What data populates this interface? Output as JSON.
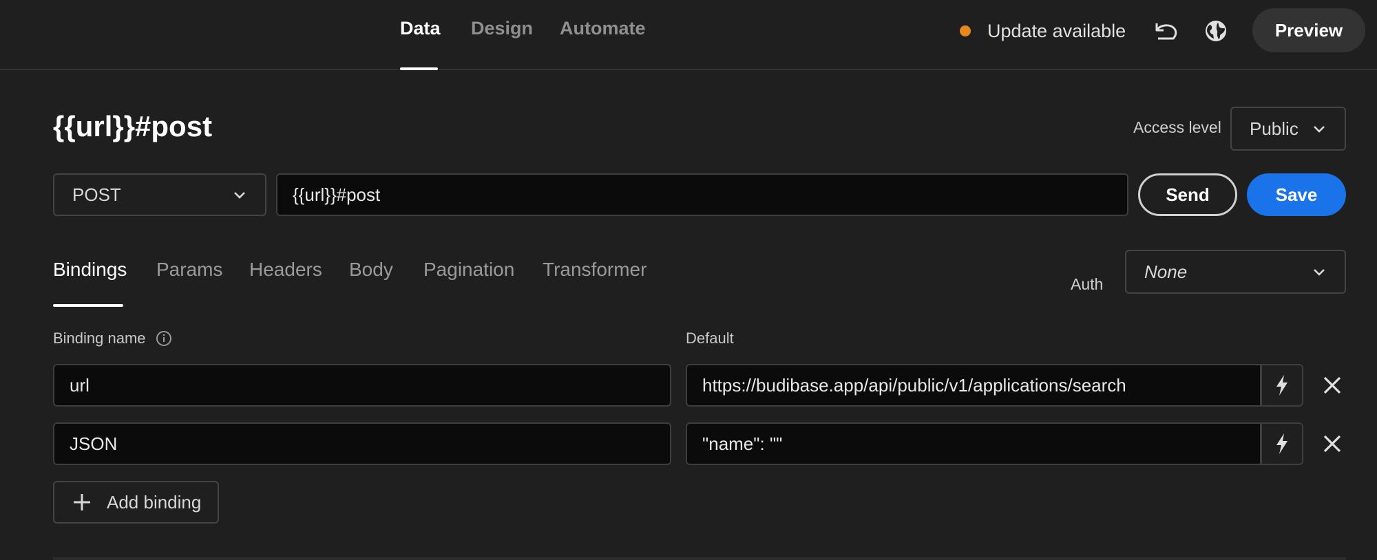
{
  "nav": {
    "tabs": [
      {
        "label": "Data",
        "active": true
      },
      {
        "label": "Design",
        "active": false
      },
      {
        "label": "Automate",
        "active": false
      }
    ],
    "update_text": "Update available",
    "update_color": "#e8871e",
    "preview_label": "Preview",
    "icons": [
      "undo-icon",
      "globe-icon"
    ]
  },
  "query": {
    "title": "{{url}}#post",
    "access_level_label": "Access level",
    "access_level_value": "Public",
    "method": "POST",
    "url": "{{url}}#post",
    "send_label": "Send",
    "save_label": "Save",
    "save_color": "#1a73e8"
  },
  "subtabs": [
    {
      "label": "Bindings",
      "active": true
    },
    {
      "label": "Params",
      "active": false
    },
    {
      "label": "Headers",
      "active": false
    },
    {
      "label": "Body",
      "active": false
    },
    {
      "label": "Pagination",
      "active": false
    },
    {
      "label": "Transformer",
      "active": false
    }
  ],
  "auth": {
    "label": "Auth",
    "value": "None"
  },
  "bindings": {
    "name_header": "Binding name",
    "default_header": "Default",
    "rows": [
      {
        "name": "url",
        "default": "https://budibase.app/api/public/v1/applications/search"
      },
      {
        "name": "JSON",
        "default": "\"name\": \"\""
      }
    ],
    "add_label": "Add binding"
  }
}
